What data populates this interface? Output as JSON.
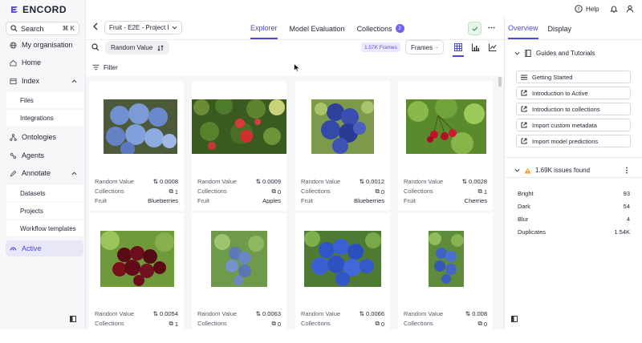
{
  "brand": {
    "logo_text": "ENCORD"
  },
  "header": {
    "help_label": "Help"
  },
  "sidebar": {
    "search_label": "Search",
    "search_shortcut": "⌘ K",
    "items": {
      "my_org": "My organisation",
      "home": "Home",
      "index": "Index",
      "files": "Files",
      "integrations": "Integrations",
      "ontologies": "Ontologies",
      "agents": "Agents",
      "annotate": "Annotate",
      "datasets": "Datasets",
      "projects": "Projects",
      "workflow_templates": "Workflow templates",
      "active": "Active"
    }
  },
  "topbar": {
    "project_name": "Fruit - E2E - Project I",
    "tabs": {
      "explorer": "Explorer",
      "model_evaluation": "Model Evaluation",
      "collections": "Collections",
      "collections_count": "2"
    }
  },
  "toolbar": {
    "sort_label": "Random Value",
    "frames_count": "1.57K Frames",
    "frames_select": "Frames"
  },
  "filter": {
    "label": "Filter"
  },
  "grid": {
    "labels": {
      "random": "Random Value",
      "collections": "Collections",
      "fruit": "Fruit"
    },
    "cards": [
      {
        "random": "0.0008",
        "collections": "1",
        "fruit": "Blueberries",
        "image": "blueberry-icon"
      },
      {
        "random": "0.0009",
        "collections": "0",
        "fruit": "Apples",
        "image": "apple-icon"
      },
      {
        "random": "0.0012",
        "collections": "0",
        "fruit": "Blueberries",
        "image": "blueberry-icon"
      },
      {
        "random": "0.0028",
        "collections": "1",
        "fruit": "Cherries",
        "image": "cherry-icon"
      },
      {
        "random": "0.0054",
        "collections": "1",
        "fruit": "",
        "image": "cherry-icon"
      },
      {
        "random": "0.0063",
        "collections": "0",
        "fruit": "",
        "image": "blueberry-icon"
      },
      {
        "random": "0.0066",
        "collections": "0",
        "fruit": "",
        "image": "blueberry-icon"
      },
      {
        "random": "0.008",
        "collections": "0",
        "fruit": "",
        "image": "blueberry-icon"
      }
    ]
  },
  "right_panel": {
    "tabs": {
      "overview": "Overview",
      "display": "Display"
    },
    "guides_title": "Guides and Tutorials",
    "guides": [
      "Getting Started",
      "Introduction to Active",
      "Introduction to collections",
      "Import custom metadata",
      "Import model predictions"
    ],
    "issues_title": "1.69K issues found",
    "issues": [
      {
        "label": "Bright",
        "value": "93"
      },
      {
        "label": "Dark",
        "value": "54"
      },
      {
        "label": "Blur",
        "value": "4"
      },
      {
        "label": "Duplicates",
        "value": "1.54K"
      }
    ]
  },
  "colors": {
    "accent": "#4a4ad6",
    "warning": "#f2a33a",
    "success": "#3ba55c"
  }
}
